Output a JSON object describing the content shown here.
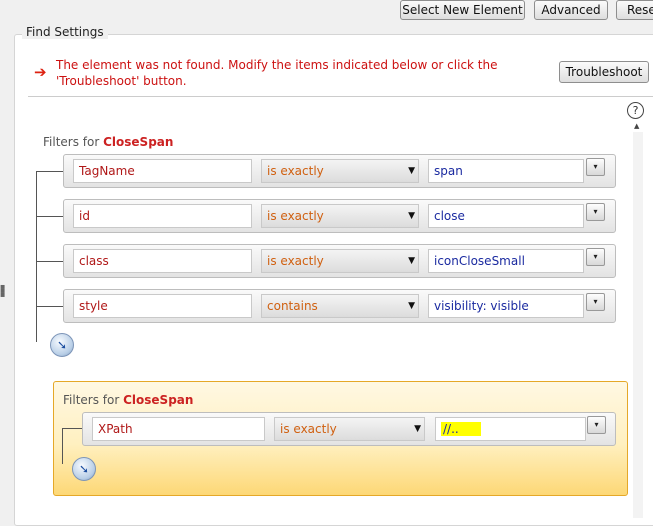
{
  "toolbar": {
    "select_new_element": "Select New Element",
    "advanced": "Advanced",
    "reset": "Reset"
  },
  "find_settings": {
    "legend": "Find Settings",
    "error_message": "The element was not found. Modify the items indicated below or click the 'Troubleshoot' button.",
    "troubleshoot_label": "Troubleshoot",
    "help": "?"
  },
  "group1": {
    "title_prefix": "Filters for ",
    "title_element": "CloseSpan",
    "rows": [
      {
        "attr": "TagName",
        "op": "is exactly",
        "value": "span"
      },
      {
        "attr": "id",
        "op": "is exactly",
        "value": "close"
      },
      {
        "attr": "class",
        "op": "is exactly",
        "value": "iconCloseSmall"
      },
      {
        "attr": "style",
        "op": "contains",
        "value": "visibility: visible"
      }
    ]
  },
  "group2": {
    "title_prefix": "Filters for ",
    "title_element": "CloseSpan",
    "rows": [
      {
        "attr": "XPath",
        "op": "is exactly",
        "value": "//.."
      }
    ],
    "highlight_color": "#ffff00"
  },
  "colors": {
    "error": "#cc1111",
    "attribute": "#b01818",
    "operator": "#d06010",
    "value": "#1a2aa0",
    "group_border": "#e5a828"
  }
}
